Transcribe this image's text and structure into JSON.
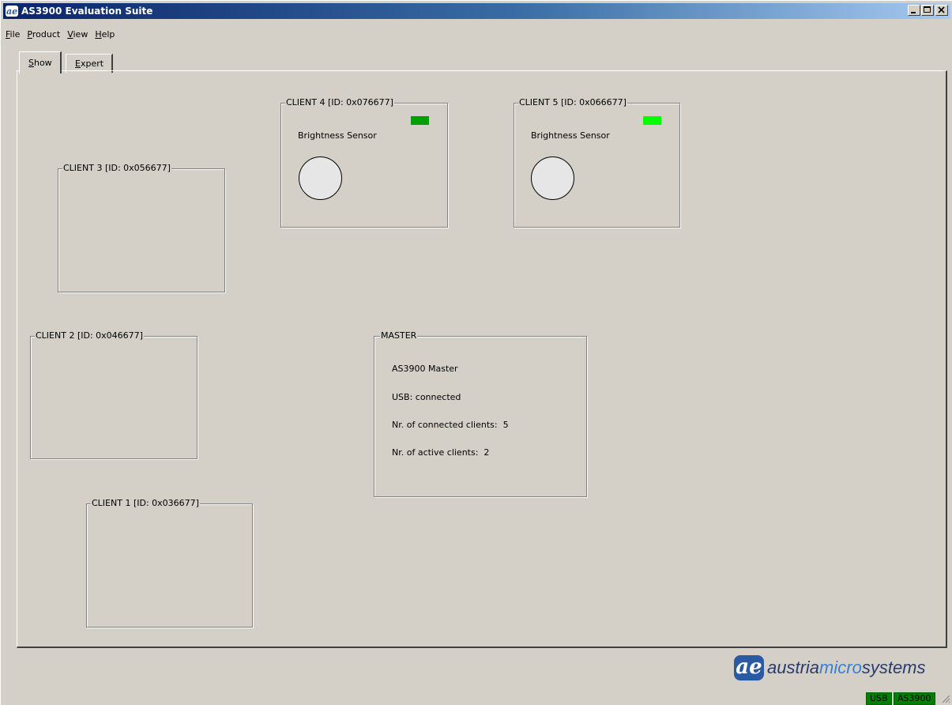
{
  "window": {
    "title": "AS3900 Evaluation Suite",
    "icon": "austriamicrosystems-app-icon"
  },
  "menu": [
    {
      "label": "File",
      "mnemonic": "F",
      "rest": "ile"
    },
    {
      "label": "Product",
      "mnemonic": "P",
      "rest": "roduct"
    },
    {
      "label": "View",
      "mnemonic": "V",
      "rest": "iew"
    },
    {
      "label": "Help",
      "mnemonic": "H",
      "rest": "elp"
    }
  ],
  "tabs": [
    {
      "label": "Show",
      "mnemonic": "S",
      "rest": "how",
      "active": true
    },
    {
      "label": "Expert",
      "mnemonic": "E",
      "rest": "xpert",
      "active": false
    }
  ],
  "clients": {
    "c4": {
      "title": "CLIENT 4 [ID: 0x076677]",
      "sensor": "Brightness Sensor",
      "led_color": "#00a000"
    },
    "c5": {
      "title": "CLIENT 5 [ID: 0x066677]",
      "sensor": "Brightness Sensor",
      "led_color": "#00ff00"
    },
    "c3": {
      "title": "CLIENT 3 [ID: 0x056677]"
    },
    "c2": {
      "title": "CLIENT 2 [ID: 0x046677]"
    },
    "c1": {
      "title": "CLIENT 1 [ID: 0x036677]"
    }
  },
  "master": {
    "title": "MASTER",
    "name": "AS3900 Master",
    "usb": "USB: connected",
    "connected_label": "Nr. of connected clients:",
    "connected_value": "5",
    "active_label": "Nr. of active clients:",
    "active_value": "2"
  },
  "logo": {
    "prefix": "austria",
    "micro": "micro",
    "suffix": "systems"
  },
  "status": {
    "usb": "USB",
    "device": "AS3900"
  },
  "colors": {
    "title_start": "#0a246a",
    "title_end": "#a6caf0",
    "status_green": "#008000"
  }
}
